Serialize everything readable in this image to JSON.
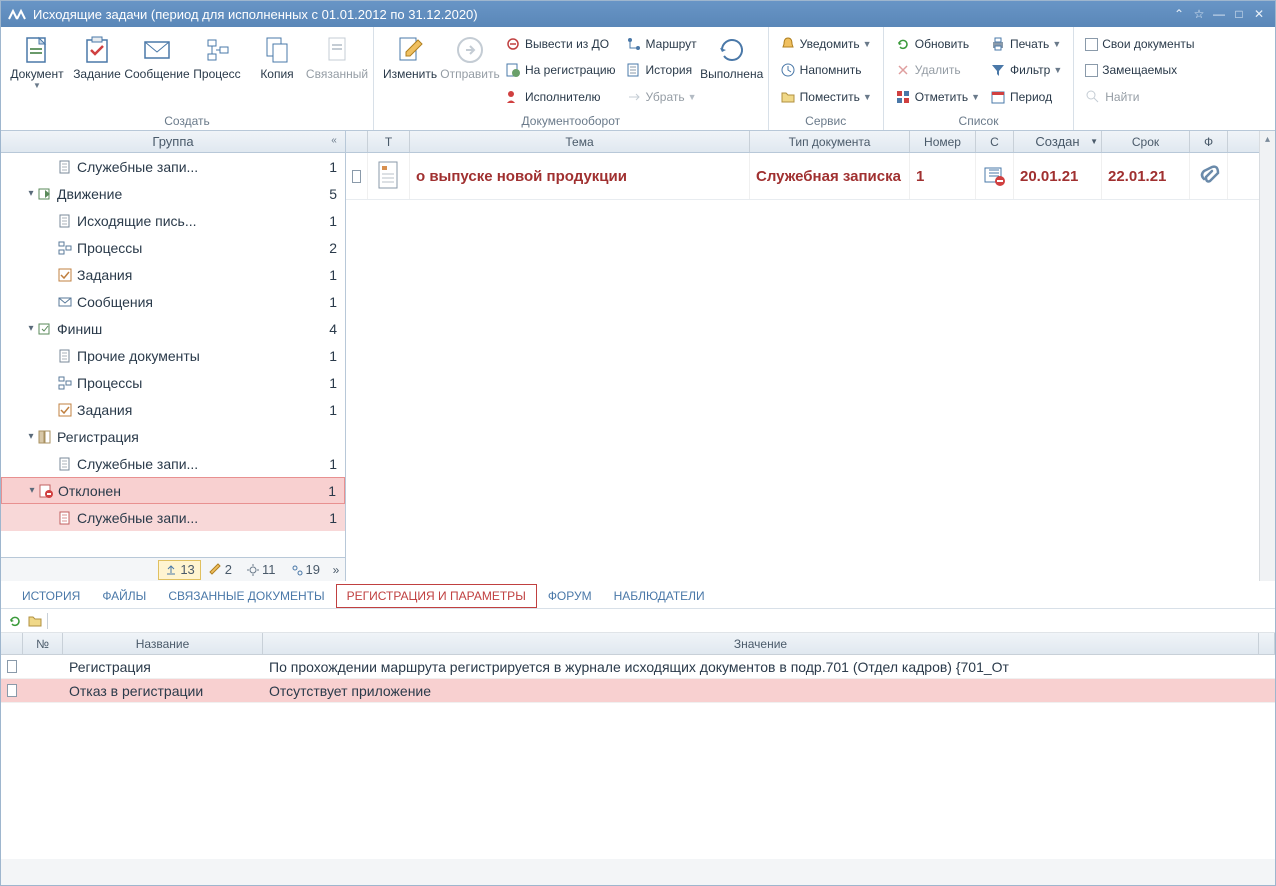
{
  "window": {
    "title": "Исходящие задачи (период для исполненных с 01.01.2012 по 31.12.2020)"
  },
  "ribbon": {
    "group_create": "Создать",
    "group_docflow": "Документооборот",
    "group_service": "Сервис",
    "group_list": "Список",
    "document": "Документ",
    "task": "Задание",
    "message": "Сообщение",
    "process": "Процесс",
    "copy": "Копия",
    "linked": "Связанный",
    "edit": "Изменить",
    "send": "Отправить",
    "out_of_do": "Вывести из ДО",
    "to_register": "На регистрацию",
    "to_executor": "Исполнителю",
    "route": "Маршрут",
    "history": "История",
    "remove": "Убрать",
    "done": "Выполнена",
    "notify": "Уведомить",
    "remind": "Напомнить",
    "place": "Поместить",
    "refresh": "Обновить",
    "delete": "Удалить",
    "mark": "Отметить",
    "print": "Печать",
    "filter": "Фильтр",
    "period": "Период",
    "my_docs": "Свои документы",
    "substituted": "Замещаемых",
    "find": "Найти"
  },
  "sidebar": {
    "header": "Группа",
    "items": [
      {
        "indent": 44,
        "icon": "doc",
        "label": "Служебные запи...",
        "count": "1"
      },
      {
        "indent": 24,
        "exp": "▾",
        "icon": "move",
        "label": "Движение",
        "count": "5"
      },
      {
        "indent": 44,
        "icon": "doc",
        "label": "Исходящие пись...",
        "count": "1"
      },
      {
        "indent": 44,
        "icon": "proc",
        "label": "Процессы",
        "count": "2"
      },
      {
        "indent": 44,
        "icon": "task",
        "label": "Задания",
        "count": "1"
      },
      {
        "indent": 44,
        "icon": "msg",
        "label": "Сообщения",
        "count": "1"
      },
      {
        "indent": 24,
        "exp": "▾",
        "icon": "finish",
        "label": "Финиш",
        "count": "4"
      },
      {
        "indent": 44,
        "icon": "doc",
        "label": "Прочие документы",
        "count": "1"
      },
      {
        "indent": 44,
        "icon": "proc",
        "label": "Процессы",
        "count": "1"
      },
      {
        "indent": 44,
        "icon": "task",
        "label": "Задания",
        "count": "1"
      },
      {
        "indent": 24,
        "exp": "▾",
        "icon": "reg",
        "label": "Регистрация",
        "count": ""
      },
      {
        "indent": 44,
        "icon": "doc",
        "label": "Служебные запи...",
        "count": "1"
      },
      {
        "indent": 24,
        "exp": "▾",
        "icon": "reject",
        "label": "Отклонен",
        "count": "1",
        "sel": true
      },
      {
        "indent": 44,
        "icon": "docred",
        "label": "Служебные запи...",
        "count": "1",
        "sel2": true
      }
    ],
    "footer": [
      {
        "v": "13",
        "active": true
      },
      {
        "v": "2"
      },
      {
        "v": "11"
      },
      {
        "v": "19"
      }
    ]
  },
  "grid": {
    "cols": [
      "",
      "Т",
      "Тема",
      "Тип документа",
      "Номер",
      "С",
      "Создан",
      "Срок",
      "Ф"
    ],
    "row": {
      "theme": "о выпуске новой продукции",
      "type": "Служебная записка",
      "num": "1",
      "created": "20.01.21",
      "due": "22.01.21"
    }
  },
  "tabs": [
    "ИСТОРИЯ",
    "ФАЙЛЫ",
    "СВЯЗАННЫЕ ДОКУМЕНТЫ",
    "РЕГИСТРАЦИЯ И ПАРАМЕТРЫ",
    "ФОРУМ",
    "НАБЛЮДАТЕЛИ"
  ],
  "tab_active": 3,
  "detail": {
    "cols": [
      "",
      "№",
      "Название",
      "Значение"
    ],
    "rows": [
      {
        "name": "Регистрация",
        "value": "По прохождении маршрута регистрируется в журнале исходящих документов в подр.701 (Отдел кадров) {701_От"
      },
      {
        "name": "Отказ в регистрации",
        "value": "Отсутствует приложение",
        "pink": true
      }
    ]
  }
}
